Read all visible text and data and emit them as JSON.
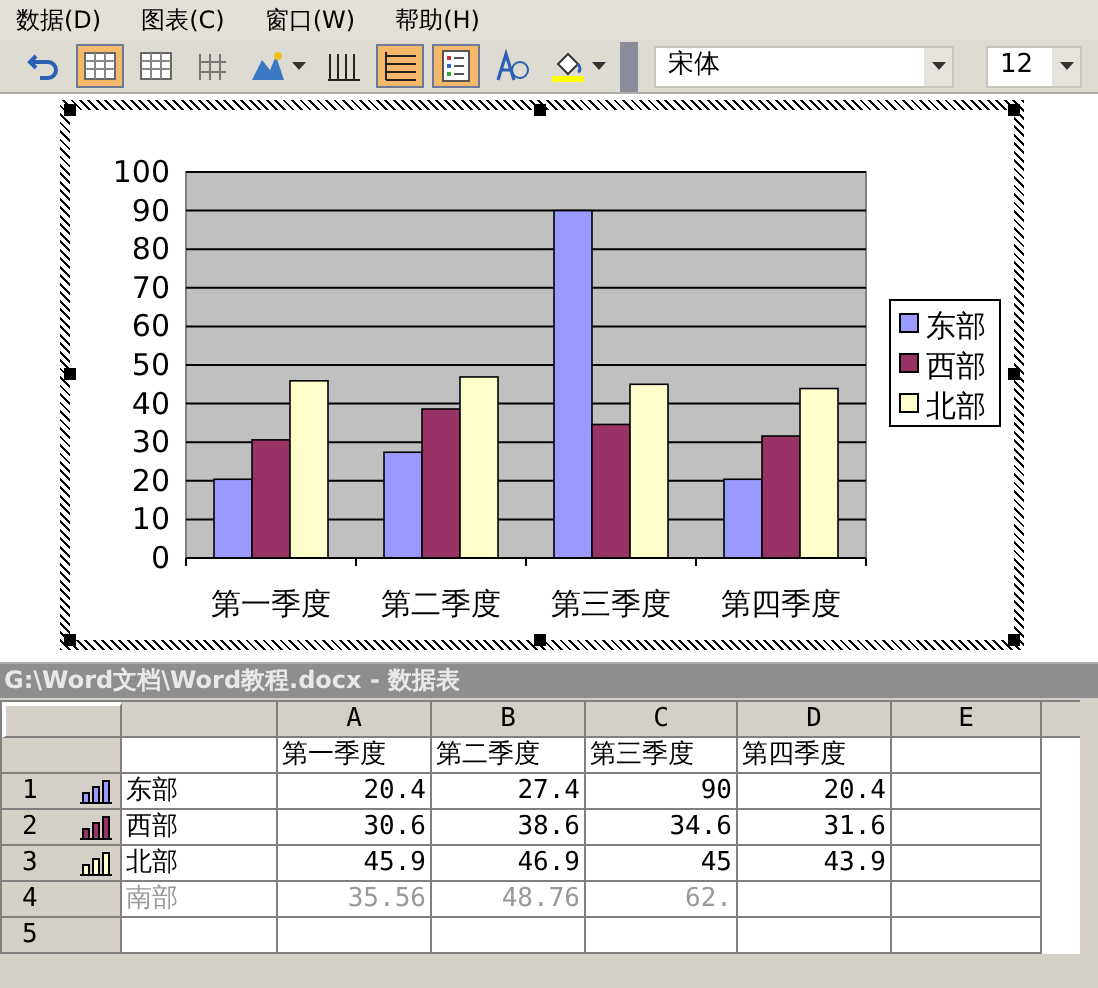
{
  "menu": [
    "数据(D)",
    "图表(C)",
    "窗口(W)",
    "帮助(H)"
  ],
  "toolbar": {
    "buttons": [
      {
        "kind": "undo",
        "selected": false
      },
      {
        "kind": "datasheet",
        "selected": true
      },
      {
        "kind": "table",
        "selected": false
      },
      {
        "kind": "grid",
        "selected": false
      },
      {
        "kind": "chart-type",
        "selected": false
      },
      {
        "kind": "by-row",
        "selected": false
      },
      {
        "kind": "by-column",
        "selected": true
      },
      {
        "kind": "legend",
        "selected": true
      },
      {
        "kind": "angle-text",
        "selected": false
      },
      {
        "kind": "fill",
        "selected": false
      }
    ],
    "font": "宋体",
    "size": "12"
  },
  "chart": {
    "chart_data": {
      "type": "bar",
      "categories": [
        "第一季度",
        "第二季度",
        "第三季度",
        "第四季度"
      ],
      "series": [
        {
          "name": "东部",
          "color": "#9999ff",
          "values": [
            20.4,
            27.4,
            90,
            20.4
          ]
        },
        {
          "name": "西部",
          "color": "#993366",
          "values": [
            30.6,
            38.6,
            34.6,
            31.6
          ]
        },
        {
          "name": "北部",
          "color": "#ffffcc",
          "values": [
            45.9,
            46.9,
            45,
            43.9
          ]
        }
      ],
      "grid": true,
      "legend": true,
      "ylim": [
        0,
        100
      ],
      "yticks": [
        0,
        10,
        20,
        30,
        40,
        50,
        60,
        70,
        80,
        90,
        100
      ]
    }
  },
  "datasheet": {
    "title": "G:\\Word文档\\Word教程.docx - 数据表",
    "columns": [
      "A",
      "B",
      "C",
      "D",
      "E"
    ],
    "header_row": [
      "第一季度",
      "第二季度",
      "第三季度",
      "第四季度"
    ],
    "rows": [
      {
        "number": "1",
        "label": "东部",
        "color": "#9999ff",
        "included": true,
        "values": [
          "20.4",
          "27.4",
          "90",
          "20.4"
        ]
      },
      {
        "number": "2",
        "label": "西部",
        "color": "#993366",
        "included": true,
        "values": [
          "30.6",
          "38.6",
          "34.6",
          "31.6"
        ]
      },
      {
        "number": "3",
        "label": "北部",
        "color": "#ffffcc",
        "included": true,
        "values": [
          "45.9",
          "46.9",
          "45",
          "43.9"
        ]
      },
      {
        "number": "4",
        "label": "南部",
        "included": false,
        "values": [
          "35.56",
          "48.76",
          "62."
        ]
      },
      {
        "number": "5",
        "values": []
      }
    ]
  }
}
